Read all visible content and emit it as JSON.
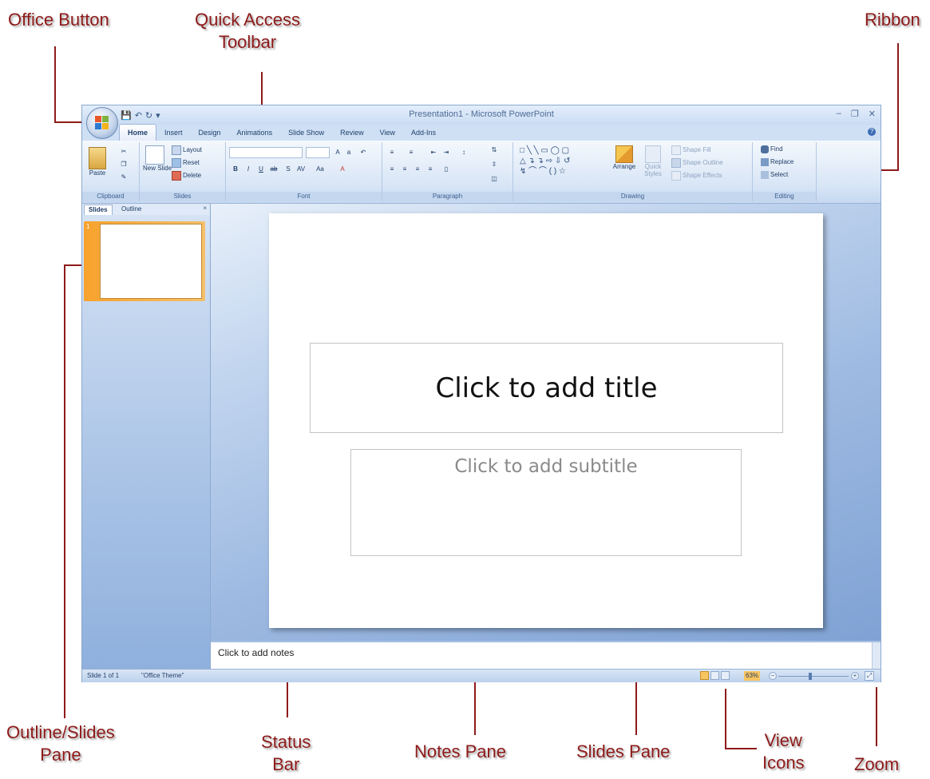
{
  "callouts": {
    "office_button": "Office Button",
    "quick_access_line1": "Quick Access",
    "quick_access_line2": "Toolbar",
    "ribbon": "Ribbon",
    "outline_slides_line1": "Outline/Slides",
    "outline_slides_line2": "Pane",
    "status_bar_line1": "Status",
    "status_bar_line2": "Bar",
    "notes_pane": "Notes Pane",
    "slides_pane": "Slides Pane",
    "view_icons_line1": "View",
    "view_icons_line2": "Icons",
    "zoom": "Zoom",
    "color": "#8e1a1a"
  },
  "window": {
    "title": "Presentation1 - Microsoft PowerPoint",
    "tabs": [
      "Home",
      "Insert",
      "Design",
      "Animations",
      "Slide Show",
      "Review",
      "View",
      "Add-Ins"
    ],
    "active_tab": "Home"
  },
  "ribbon": {
    "clipboard": {
      "label": "Clipboard",
      "paste": "Paste"
    },
    "slides": {
      "label": "Slides",
      "new_slide": "New Slide",
      "layout": "Layout",
      "reset": "Reset",
      "delete": "Delete"
    },
    "font": {
      "label": "Font"
    },
    "paragraph": {
      "label": "Paragraph"
    },
    "drawing": {
      "label": "Drawing",
      "arrange": "Arrange",
      "quick_styles": "Quick Styles",
      "shape_fill": "Shape Fill",
      "shape_outline": "Shape Outline",
      "shape_effects": "Shape Effects"
    },
    "editing": {
      "label": "Editing",
      "find": "Find",
      "replace": "Replace",
      "select": "Select"
    }
  },
  "left_pane": {
    "tabs": [
      "Slides",
      "Outline"
    ],
    "close": "×",
    "thumb_number": "1"
  },
  "slide": {
    "title_placeholder": "Click to add title",
    "subtitle_placeholder": "Click to add subtitle"
  },
  "notes": {
    "placeholder": "Click to add notes"
  },
  "status_bar": {
    "slide_info": "Slide 1 of 1",
    "theme": "\"Office Theme\"",
    "zoom": "63%",
    "zoom_level": 0.45
  }
}
